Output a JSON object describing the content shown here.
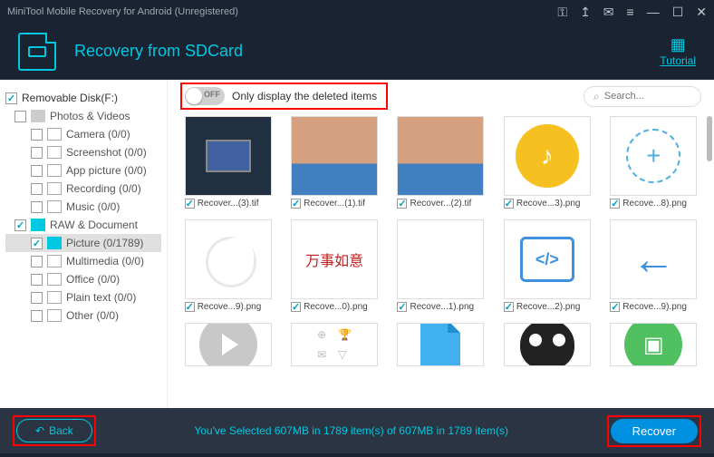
{
  "titlebar": {
    "text": "MiniTool Mobile Recovery for Android (Unregistered)"
  },
  "header": {
    "title": "Recovery from SDCard",
    "tutorial": "Tutorial"
  },
  "sidebar": {
    "root": {
      "label": "Removable Disk(F:)",
      "checked": true
    },
    "groups": [
      {
        "label": "Photos & Videos",
        "checked": false,
        "icon": "folder",
        "items": [
          {
            "label": "Camera (0/0)",
            "checked": false
          },
          {
            "label": "Screenshot (0/0)",
            "checked": false
          },
          {
            "label": "App picture (0/0)",
            "checked": false
          },
          {
            "label": "Recording (0/0)",
            "checked": false
          },
          {
            "label": "Music (0/0)",
            "checked": false
          }
        ]
      },
      {
        "label": "RAW & Document",
        "checked": true,
        "icon": "raw",
        "items": [
          {
            "label": "Picture (0/1789)",
            "checked": true,
            "selected": true
          },
          {
            "label": "Multimedia (0/0)",
            "checked": false
          },
          {
            "label": "Office (0/0)",
            "checked": false
          },
          {
            "label": "Plain text (0/0)",
            "checked": false
          },
          {
            "label": "Other (0/0)",
            "checked": false
          }
        ]
      }
    ]
  },
  "toolbar": {
    "toggle_state": "OFF",
    "toggle_label": "Only display the deleted items",
    "search_placeholder": "Search..."
  },
  "thumbnails": [
    {
      "name": "Recover...(3).tif",
      "vis": "monitor"
    },
    {
      "name": "Recover...(1).tif",
      "vis": "hand"
    },
    {
      "name": "Recover...(2).tif",
      "vis": "hand"
    },
    {
      "name": "Recove...3).png",
      "vis": "music"
    },
    {
      "name": "Recove...8).png",
      "vis": "plus"
    },
    {
      "name": "Recove...9).png",
      "vis": "moon"
    },
    {
      "name": "Recove...0).png",
      "vis": "red"
    },
    {
      "name": "Recove...1).png",
      "vis": "blank"
    },
    {
      "name": "Recove...2).png",
      "vis": "code"
    },
    {
      "name": "Recove...9).png",
      "vis": "arrow"
    },
    {
      "name": "",
      "vis": "play"
    },
    {
      "name": "",
      "vis": "icons"
    },
    {
      "name": "",
      "vis": "doc"
    },
    {
      "name": "",
      "vis": "face"
    },
    {
      "name": "",
      "vis": "green"
    }
  ],
  "footer": {
    "back": "Back",
    "status": "You've Selected 607MB in 1789 item(s) of 607MB in 1789 item(s)",
    "recover": "Recover"
  }
}
